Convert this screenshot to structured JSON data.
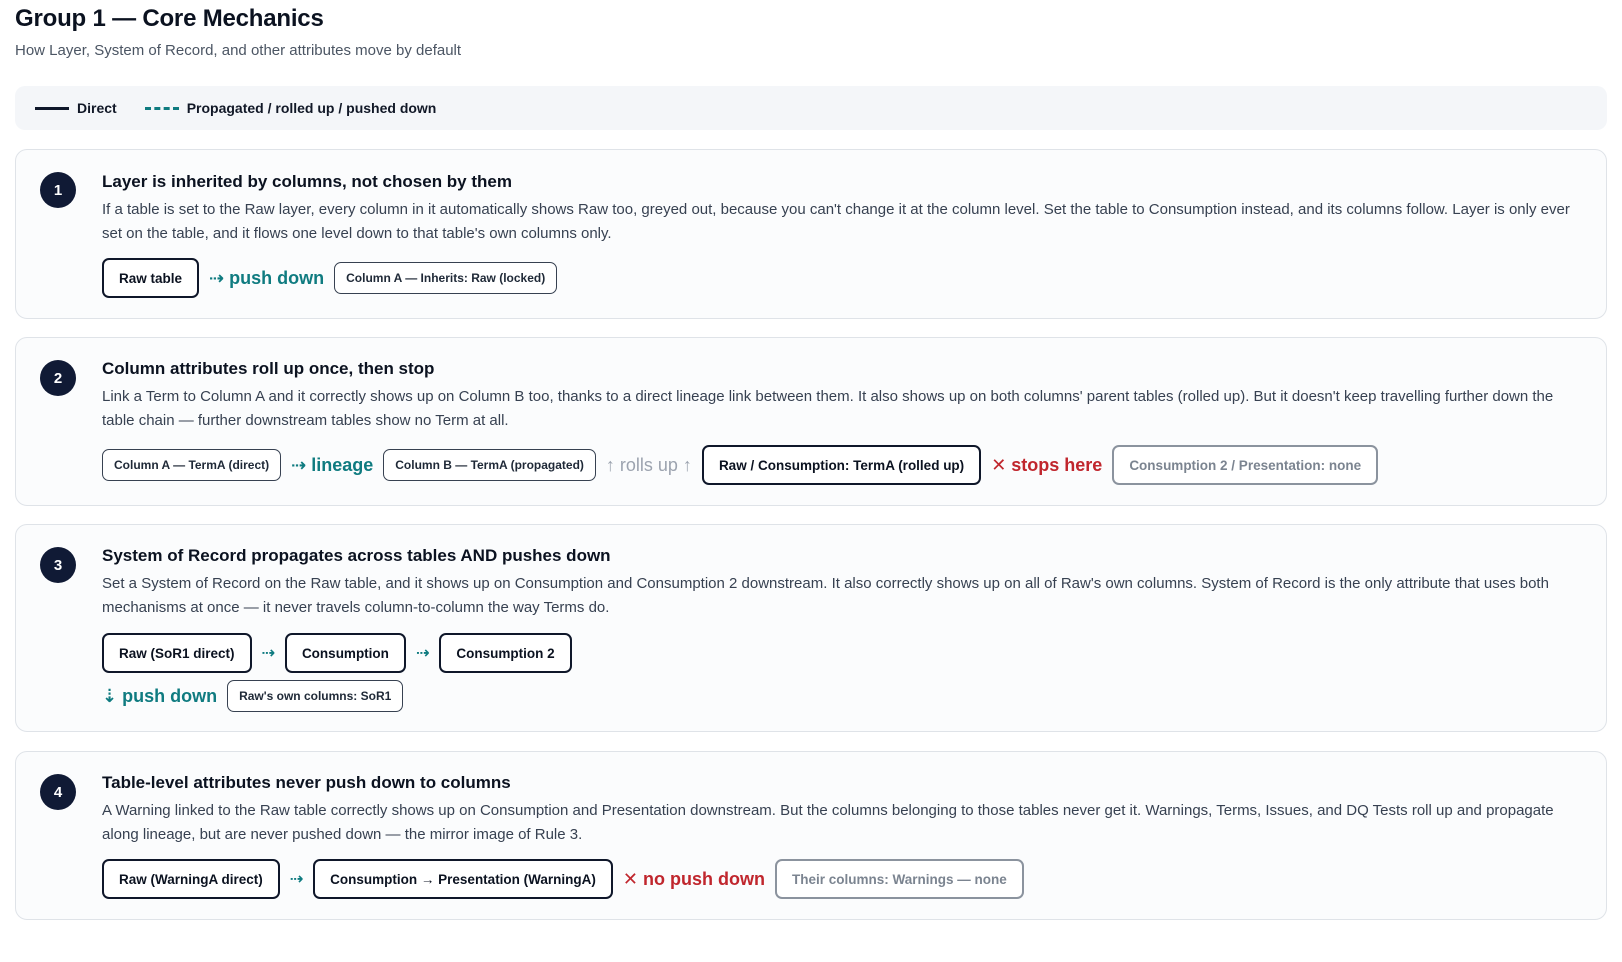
{
  "header": {
    "title": "Group 1 — Core Mechanics",
    "subtitle": "How Layer, System of Record, and other attributes move by default"
  },
  "legend": {
    "direct": "Direct",
    "propagated": "Propagated / rolled up / pushed down"
  },
  "rules": [
    {
      "number": "1",
      "title": "Layer is inherited by columns, not chosen by them",
      "description": "If a table is set to the Raw layer, every column in it automatically shows Raw too, greyed out, because you can't change it at the column level. Set the table to Consumption instead, and its columns follow. Layer is only ever set on the table, and it flows one level down to that table's own columns only.",
      "flow": {
        "box1": "Raw table",
        "conn1": "⇢ push down",
        "box2": "Column A — Inherits: Raw (locked)"
      }
    },
    {
      "number": "2",
      "title": "Column attributes roll up once, then stop",
      "description": "Link a Term to Column A and it correctly shows up on Column B too, thanks to a direct lineage link between them. It also shows up on both columns' parent tables (rolled up). But it doesn't keep travelling further down the table chain — further downstream tables show no Term at all.",
      "flow": {
        "box1": "Column A — TermA (direct)",
        "conn1": "⇢ lineage",
        "box2": "Column B — TermA (propagated)",
        "conn2": "↑ rolls up ↑",
        "box3": "Raw / Consumption: TermA (rolled up)",
        "conn3": "✕ stops here",
        "box4": "Consumption 2 / Presentation: none"
      }
    },
    {
      "number": "3",
      "title": "System of Record propagates across tables AND pushes down",
      "description": "Set a System of Record on the Raw table, and it shows up on Consumption and Consumption 2 downstream.  It also correctly shows up on all of Raw's own columns. System of Record is the only attribute that uses both mechanisms at once — it never travels column-to-column the way Terms do.",
      "flow": {
        "box1": "Raw (SoR1 direct)",
        "conn1": "⇢",
        "box2": "Consumption",
        "conn2": "⇢",
        "box3": "Consumption 2"
      },
      "subflow": {
        "conn": "⇣ push down",
        "box": "Raw's own columns: SoR1"
      }
    },
    {
      "number": "4",
      "title": "Table-level attributes never push down to columns",
      "description": "A Warning linked to the Raw table correctly shows up on Consumption and Presentation downstream. But the columns belonging to those tables never get it. Warnings, Terms, Issues, and DQ Tests roll up and propagate along lineage, but are never pushed down — the mirror image of Rule 3.",
      "flow": {
        "box1": "Raw (WarningA direct)",
        "conn1": "⇢",
        "box2": "Consumption → Presentation (WarningA)",
        "conn2": "✕ no push down",
        "box3": "Their columns: Warnings — none"
      }
    }
  ],
  "colors": {
    "navy": "#101a35",
    "teal": "#0f7b80",
    "red": "#c0262d",
    "grey": "#9ca3af"
  }
}
